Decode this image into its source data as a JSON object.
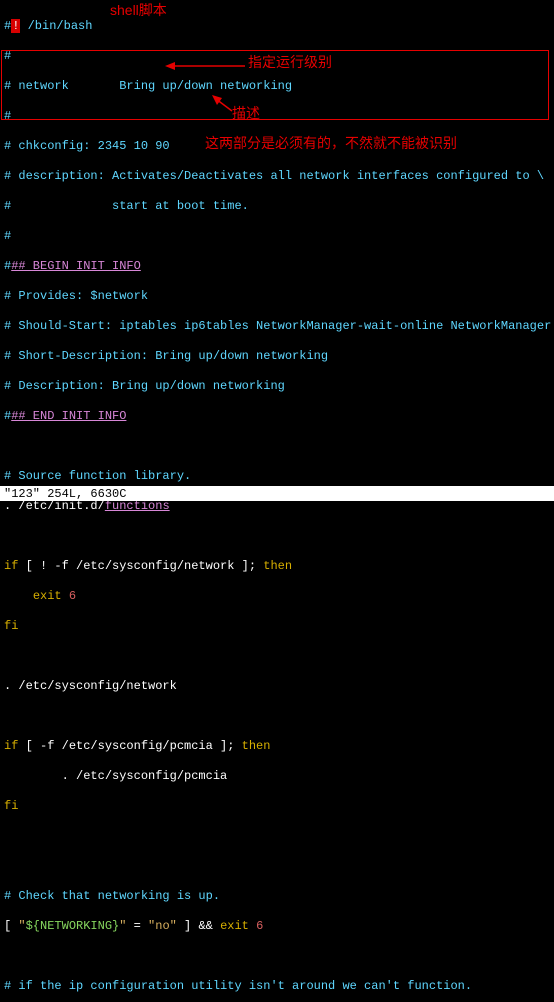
{
  "annotations": {
    "shell_script": "shell脚本",
    "specify_runlevel": "指定运行级别",
    "description": "描述",
    "two_parts_required": "这两部分是必须有的，不然就不能被识别"
  },
  "code": {
    "l1a": "#",
    "l1b": "!",
    "l1c": " /bin/bash",
    "l2": "#",
    "l3": "# network       Bring up/down networking",
    "l4": "#",
    "l5": "# chkconfig: 2345 10 90",
    "l6": "# description: Activates/Deactivates all network interfaces configured to \\",
    "l7": "#              start at boot time.",
    "l8": "#",
    "l9a": "#",
    "l9b": "## BEGIN INIT INFO",
    "l10": "# Provides: $network",
    "l11": "# Should-Start: iptables ip6tables NetworkManager-wait-online NetworkManager",
    "l12": "# Short-Description: Bring up/down networking",
    "l13": "# Description: Bring up/down networking",
    "l14a": "#",
    "l14b": "## END INIT INFO",
    "l15": "",
    "l16": "# Source function library.",
    "l17a": ". /etc/init.d/",
    "l17b": "functions",
    "l18": "",
    "l19a": "if",
    "l19b": " [ ! -f /etc/sysconfig/network ]; ",
    "l19c": "then",
    "l20a": "    ",
    "l20b": "exit",
    "l20c": " ",
    "l20d": "6",
    "l21": "fi",
    "l22": "",
    "l23": ". /etc/sysconfig/network",
    "l24": "",
    "l25a": "if",
    "l25b": " [ -f /etc/sysconfig/pcmcia ]; ",
    "l25c": "then",
    "l26": "        . /etc/sysconfig/pcmcia",
    "l27": "fi",
    "l28": "",
    "l29": "",
    "l30": "# Check that networking is up.",
    "l31a": "[ ",
    "l31b": "\"",
    "l31c": "${NETWORKING}",
    "l31d": "\"",
    "l31e": " = ",
    "l31f": "\"no\"",
    "l31g": " ] && ",
    "l31h": "exit",
    "l31i": " ",
    "l31j": "6",
    "l32": "",
    "l33": "# if the ip configuration utility isn't around we can't function."
  },
  "status": "\"123\" 254L, 6630C"
}
